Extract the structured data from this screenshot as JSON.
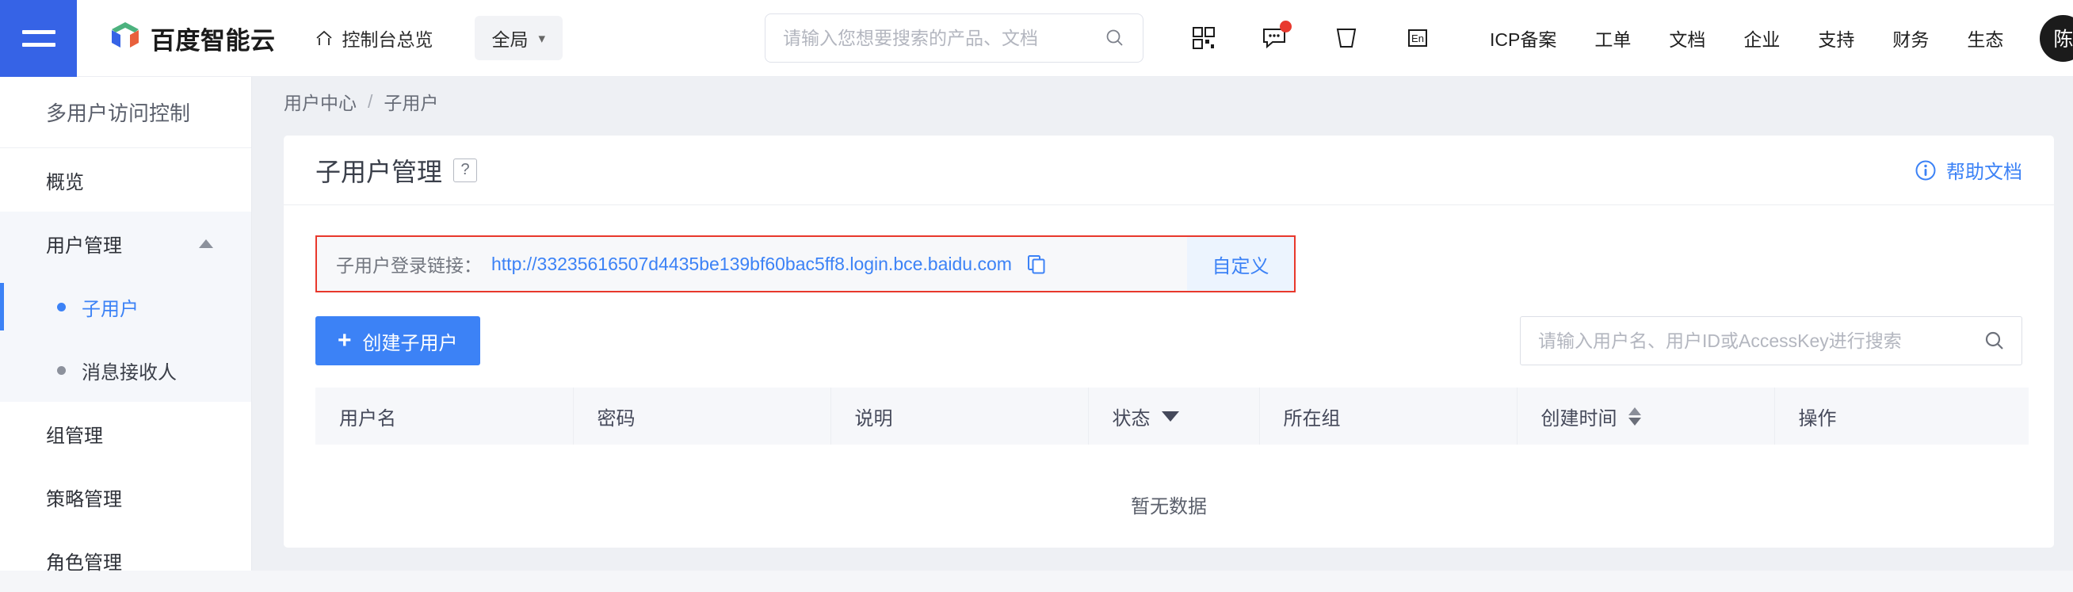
{
  "header": {
    "menu_icon": "hamburger-icon",
    "brand": "百度智能云",
    "console_overview": "控制台总览",
    "region": "全局",
    "search_placeholder": "请输入您想要搜索的产品、文档",
    "search_value": "",
    "icons": [
      "qrcode-icon",
      "message-icon",
      "cart-icon",
      "language-en-icon"
    ],
    "links": [
      "ICP备案",
      "工单",
      "文档",
      "企业",
      "支持",
      "财务",
      "生态"
    ],
    "avatar_text": "陈",
    "accent": "#3663e6"
  },
  "sidebar": {
    "title": "多用户访问控制",
    "items": [
      {
        "label": "概览",
        "type": "item"
      },
      {
        "label": "用户管理",
        "type": "group",
        "expanded": true,
        "children": [
          {
            "label": "子用户",
            "active": true
          },
          {
            "label": "消息接收人",
            "active": false
          }
        ]
      },
      {
        "label": "组管理",
        "type": "item"
      },
      {
        "label": "策略管理",
        "type": "item"
      },
      {
        "label": "角色管理",
        "type": "item"
      }
    ]
  },
  "breadcrumb": {
    "parent": "用户中心",
    "separator": "/",
    "current": "子用户"
  },
  "page": {
    "title": "子用户管理",
    "help_badge": "?",
    "help_doc": "帮助文档",
    "help_doc_icon": "info-circle-icon"
  },
  "login_link": {
    "label": "子用户登录链接：",
    "url": "http://33235616507d4435be139bf60bac5ff8.login.bce.baidu.com",
    "copy_icon": "copy-icon",
    "custom_button": "自定义",
    "highlight_color": "#e8382c"
  },
  "toolbar": {
    "create_label": "创建子用户",
    "create_icon": "plus-icon",
    "search_placeholder": "请输入用户名、用户ID或AccessKey进行搜索",
    "search_value": "",
    "search_icon": "search-icon"
  },
  "table": {
    "columns": [
      {
        "label": "用户名",
        "sort": "none"
      },
      {
        "label": "密码",
        "sort": "none"
      },
      {
        "label": "说明",
        "sort": "none"
      },
      {
        "label": "状态",
        "sort": "filter"
      },
      {
        "label": "所在组",
        "sort": "none"
      },
      {
        "label": "创建时间",
        "sort": "both"
      },
      {
        "label": "操作",
        "sort": "none"
      }
    ],
    "rows": [],
    "empty_text": "暂无数据"
  }
}
